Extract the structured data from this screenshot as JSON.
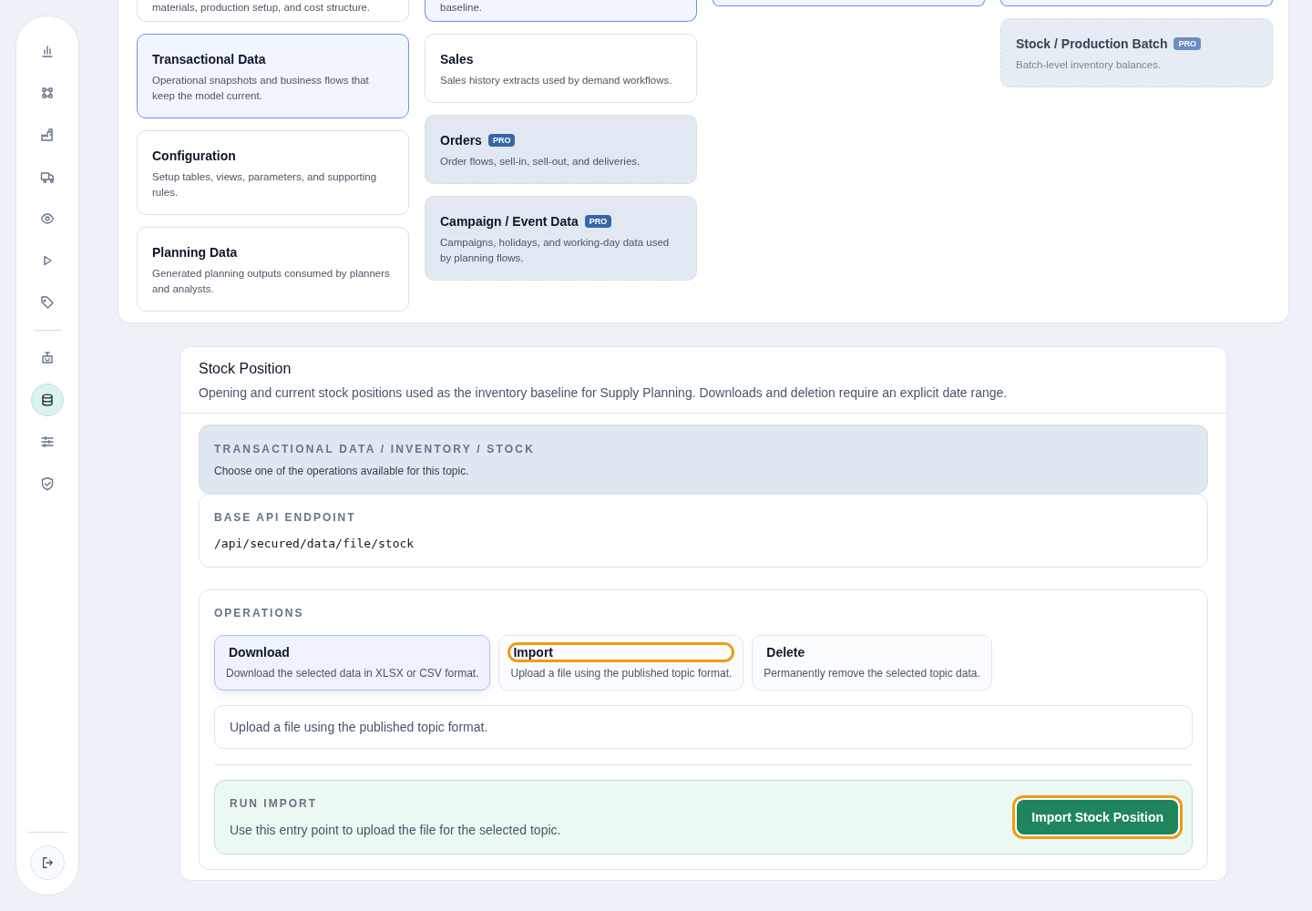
{
  "sidebar": {
    "groups": [
      {
        "items": [
          {
            "selected": false
          },
          {
            "selected": false
          },
          {
            "selected": false
          },
          {
            "selected": false
          },
          {
            "selected": false
          },
          {
            "selected": false
          },
          {
            "selected": false
          }
        ]
      },
      {
        "items": [
          {
            "selected": false
          },
          {
            "selected": true
          },
          {
            "selected": false
          },
          {
            "selected": false
          }
        ]
      }
    ],
    "footer": {
      "kind": "logout"
    }
  },
  "catalog": {
    "columns": [
      {
        "cards": [
          {
            "kind": "cut",
            "description": "materials, production setup, and cost structure.",
            "selected": false
          },
          {
            "kind": "full",
            "title": "Transactional Data",
            "description": "Operational snapshots and business flows that keep the model current.",
            "selected": true,
            "pro": false,
            "dimmed": false
          },
          {
            "kind": "full",
            "title": "Configuration",
            "description": "Setup tables, views, parameters, and supporting rules.",
            "selected": false,
            "pro": false,
            "dimmed": false
          },
          {
            "kind": "full",
            "title": "Planning Data",
            "description": "Generated planning outputs consumed by planners and analysts.",
            "selected": false,
            "pro": false,
            "dimmed": false
          }
        ]
      },
      {
        "cards": [
          {
            "kind": "cut",
            "description": "baseline.",
            "selected": true
          },
          {
            "kind": "full",
            "title": "Sales",
            "description": "Sales history extracts used by demand workflows.",
            "selected": false,
            "pro": false,
            "dimmed": false
          },
          {
            "kind": "full",
            "title": "Orders",
            "badge": "PRO",
            "description": "Order flows, sell-in, sell-out, and deliveries.",
            "selected": false,
            "pro": true,
            "dimmed": false
          },
          {
            "kind": "full",
            "title": "Campaign / Event Data",
            "badge": "PRO",
            "description": "Campaigns, holidays, and working-day data used by planning flows.",
            "selected": false,
            "pro": true,
            "dimmed": false
          }
        ]
      },
      {
        "cards": [
          {
            "kind": "edge",
            "selected": true
          }
        ]
      },
      {
        "cards": [
          {
            "kind": "edge",
            "selected": true
          },
          {
            "kind": "full",
            "title": "Stock / Production Batch",
            "badge": "PRO",
            "description": "Batch-level inventory balances.",
            "selected": false,
            "pro": true,
            "dimmed": true
          }
        ]
      }
    ]
  },
  "detail": {
    "title": "Stock Position",
    "description": "Opening and current stock positions used as the inventory baseline for Supply Planning. Downloads and deletion require an explicit date range.",
    "breadcrumb": "TRANSACTIONAL DATA / INVENTORY / STOCK",
    "breadcrumb_note": "Choose one of the operations available for this topic.",
    "endpoint_label": "BASE API ENDPOINT",
    "endpoint": "/api/secured/data/file/stock",
    "operations": {
      "label": "OPERATIONS",
      "items": [
        {
          "title": "Download",
          "description": "Download the selected data in XLSX or CSV format.",
          "selected": true,
          "focused": false
        },
        {
          "title": "Import",
          "description": "Upload a file using the published topic format.",
          "selected": false,
          "focused": true
        },
        {
          "title": "Delete",
          "description": "Permanently remove the selected topic data.",
          "selected": false,
          "focused": false
        }
      ],
      "summary": "Upload a file using the published topic format.",
      "run": {
        "label": "RUN IMPORT",
        "text": "Use this entry point to upload the file for the selected topic.",
        "button": "Import Stock Position",
        "button_focused": true
      }
    }
  }
}
